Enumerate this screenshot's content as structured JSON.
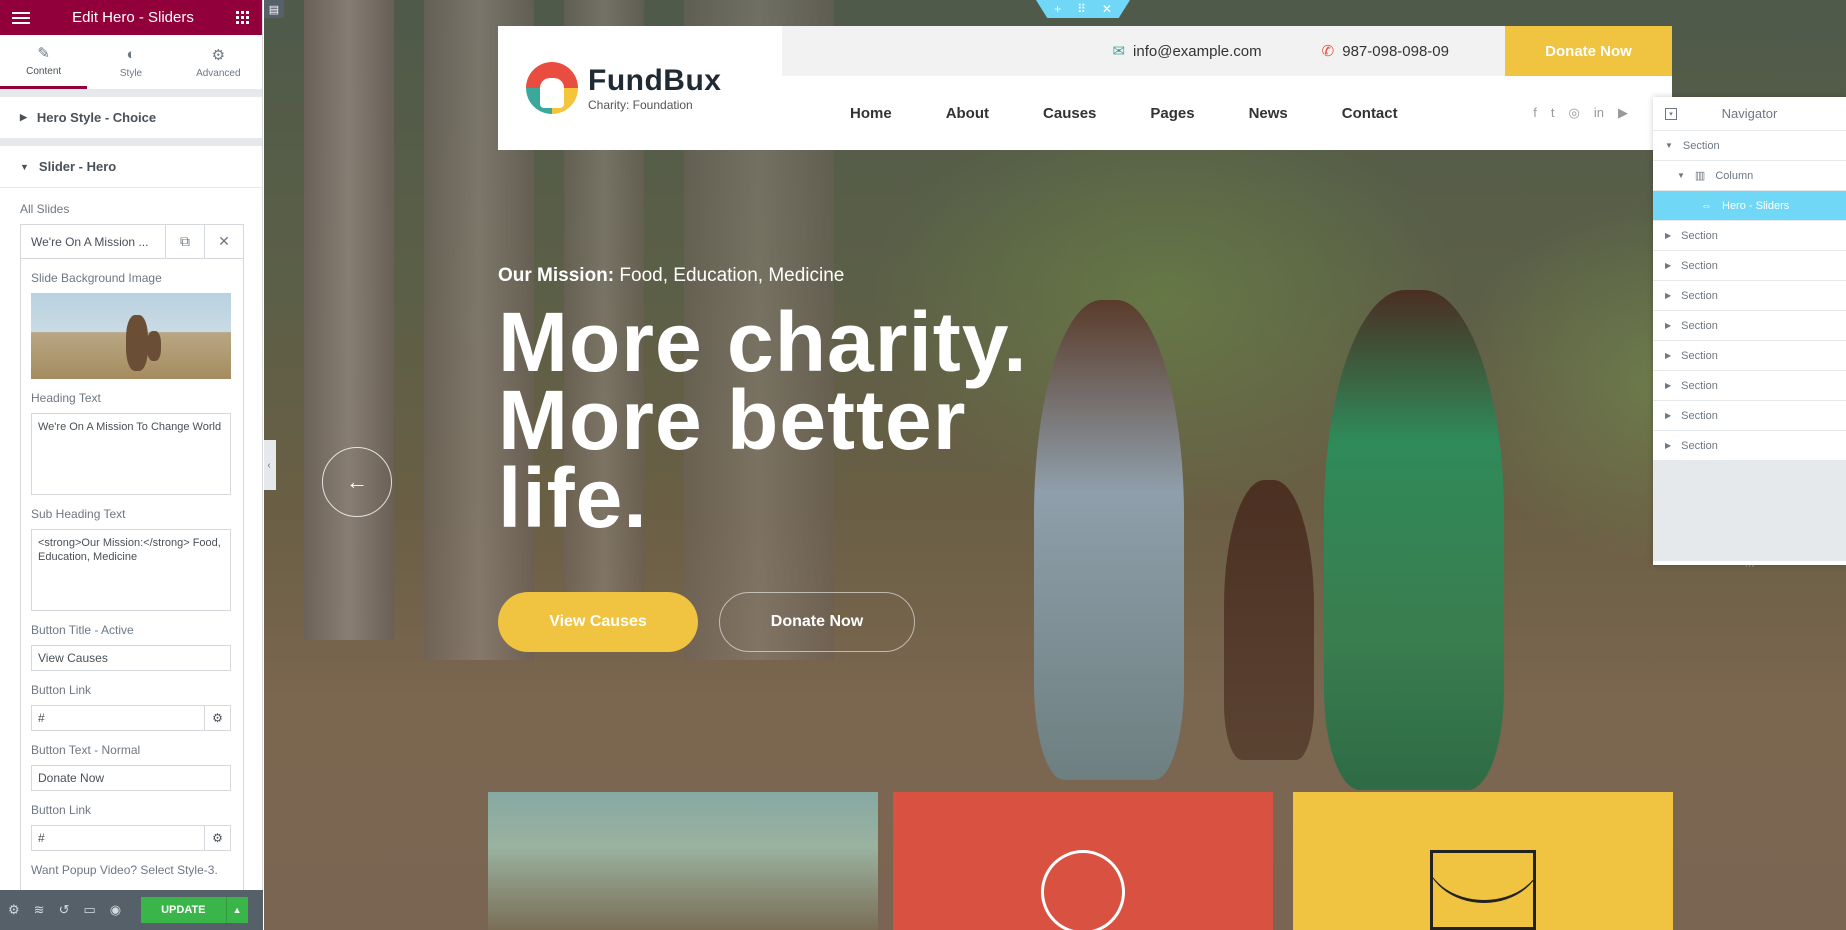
{
  "panel": {
    "title": "Edit Hero - Sliders",
    "tabs": [
      {
        "label": "Content",
        "icon": "pencil-icon"
      },
      {
        "label": "Style",
        "icon": "contrast-icon"
      },
      {
        "label": "Advanced",
        "icon": "gear-icon"
      }
    ],
    "sections": {
      "hero_style": "Hero Style - Choice",
      "slider_hero": "Slider - Hero"
    },
    "all_slides_label": "All Slides",
    "slide_item_title": "We're On A Mission ...",
    "fields": {
      "bg_image_label": "Slide Background Image",
      "heading_label": "Heading Text",
      "heading_value": "We're On A Mission To Change World",
      "subheading_label": "Sub Heading Text",
      "subheading_value": "<strong>Our Mission:</strong> Food, Education, Medicine",
      "button_title_active_label": "Button Title - Active",
      "button_title_active_value": "View Causes",
      "button_link1_label": "Button Link",
      "button_link1_value": "#",
      "button_text_normal_label": "Button Text - Normal",
      "button_text_normal_value": "Donate Now",
      "button_link2_label": "Button Link",
      "button_link2_value": "#",
      "popup_label": "Want Popup Video? Select Style-3."
    },
    "footer": {
      "update_label": "UPDATE"
    }
  },
  "site": {
    "brand": "FundBux",
    "brand_sub": "Charity: Foundation",
    "email": "info@example.com",
    "phone": "987-098-098-09",
    "donate_top": "Donate Now",
    "nav": [
      "Home",
      "About",
      "Causes",
      "Pages",
      "News",
      "Contact"
    ],
    "social_icons": [
      "facebook-icon",
      "twitter-icon",
      "instagram-icon",
      "linkedin-icon",
      "youtube-icon"
    ]
  },
  "hero": {
    "sub_strong": "Our Mission:",
    "sub_rest": "Food, Education, Medicine",
    "title_line1": "More charity.",
    "title_line2": "More better",
    "title_line3": "life.",
    "btn_primary": "View Causes",
    "btn_secondary": "Donate Now"
  },
  "navigator": {
    "title": "Navigator",
    "items": [
      {
        "label": "Section",
        "level": 0,
        "state": "expanded"
      },
      {
        "label": "Column",
        "level": 1,
        "state": "expanded"
      },
      {
        "label": "Hero - Sliders",
        "level": 2,
        "state": "active"
      },
      {
        "label": "Section",
        "level": 0
      },
      {
        "label": "Section",
        "level": 0
      },
      {
        "label": "Section",
        "level": 0
      },
      {
        "label": "Section",
        "level": 0
      },
      {
        "label": "Section",
        "level": 0
      },
      {
        "label": "Section",
        "level": 0
      },
      {
        "label": "Section",
        "level": 0
      },
      {
        "label": "Section",
        "level": 0
      }
    ]
  },
  "colors": {
    "elementor_maroon": "#92003b",
    "accent_yellow": "#f0c341",
    "card_red": "#d95140",
    "navigator_active": "#71d7f7",
    "update_green": "#39b54a"
  }
}
